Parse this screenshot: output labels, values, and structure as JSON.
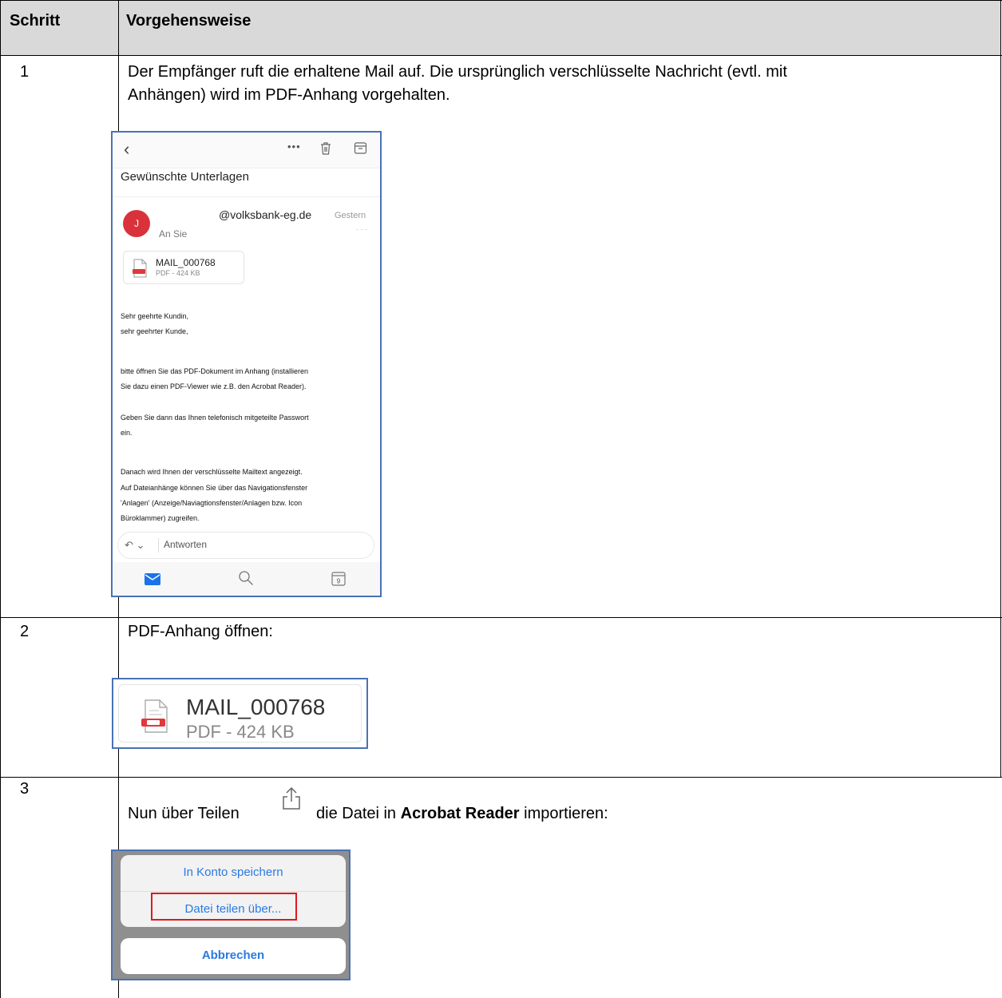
{
  "table": {
    "headers": [
      "Schritt",
      "Vorgehensweise"
    ],
    "rows": [
      {
        "step": "1",
        "text_line1": "Der Empfänger ruft die erhaltene Mail auf. Die ursprünglich verschlüsselte Nachricht (evtl. mit",
        "text_line2": "Anhängen) wird im PDF-Anhang vorgehalten."
      },
      {
        "step": "2",
        "text": "PDF-Anhang öffnen:"
      },
      {
        "step": "3",
        "text_before": "Nun über Teilen",
        "text_middle": "die Datei in",
        "text_bold": "Acrobat Reader",
        "text_after": "importieren:"
      }
    ]
  },
  "mail_screen": {
    "subject": "Gewünschte Unterlagen",
    "avatar_initial": "J",
    "sender": "@volksbank-eg.de",
    "date": "Gestern",
    "recipient": "An Sie",
    "more": "· · ·",
    "attachment": {
      "name": "MAIL_000768",
      "size": "PDF - 424 KB"
    },
    "body_lines": [
      "Sehr geehrte Kundin,",
      "sehr geehrter Kunde,",
      "bitte öffnen Sie das PDF-Dokument im Anhang (installieren",
      "Sie dazu einen PDF-Viewer wie z.B. den Acrobat Reader).",
      "Geben Sie dann das Ihnen telefonisch mitgeteilte Passwort",
      "ein.",
      "Danach wird Ihnen der verschlüsselte Mailtext angezeigt.",
      "Auf Dateianhänge können Sie über das Navigationsfenster",
      "'Anlagen' (Anzeige/Naviagtionsfenster/Anlagen bzw. Icon",
      "Büroklammer) zugreifen."
    ],
    "reply_label": "Antworten",
    "calendar_day": "9",
    "icons": [
      "back-icon",
      "more-icon",
      "trash-icon",
      "archive-icon",
      "pdf-icon",
      "reply-icon",
      "mail-icon",
      "search-icon",
      "calendar-icon"
    ]
  },
  "attachment_zoom": {
    "name": "MAIL_000768",
    "size": "PDF - 424 KB"
  },
  "share_sheet": {
    "option1": "In Konto speichern",
    "option2": "Datei teilen über...",
    "cancel": "Abbrechen"
  },
  "colors": {
    "header_bg": "#d9d9d9",
    "frame": "#4a72b5",
    "highlight": "#e0191b",
    "ios_blue": "#2a7ae2",
    "avatar": "#d9323a"
  }
}
